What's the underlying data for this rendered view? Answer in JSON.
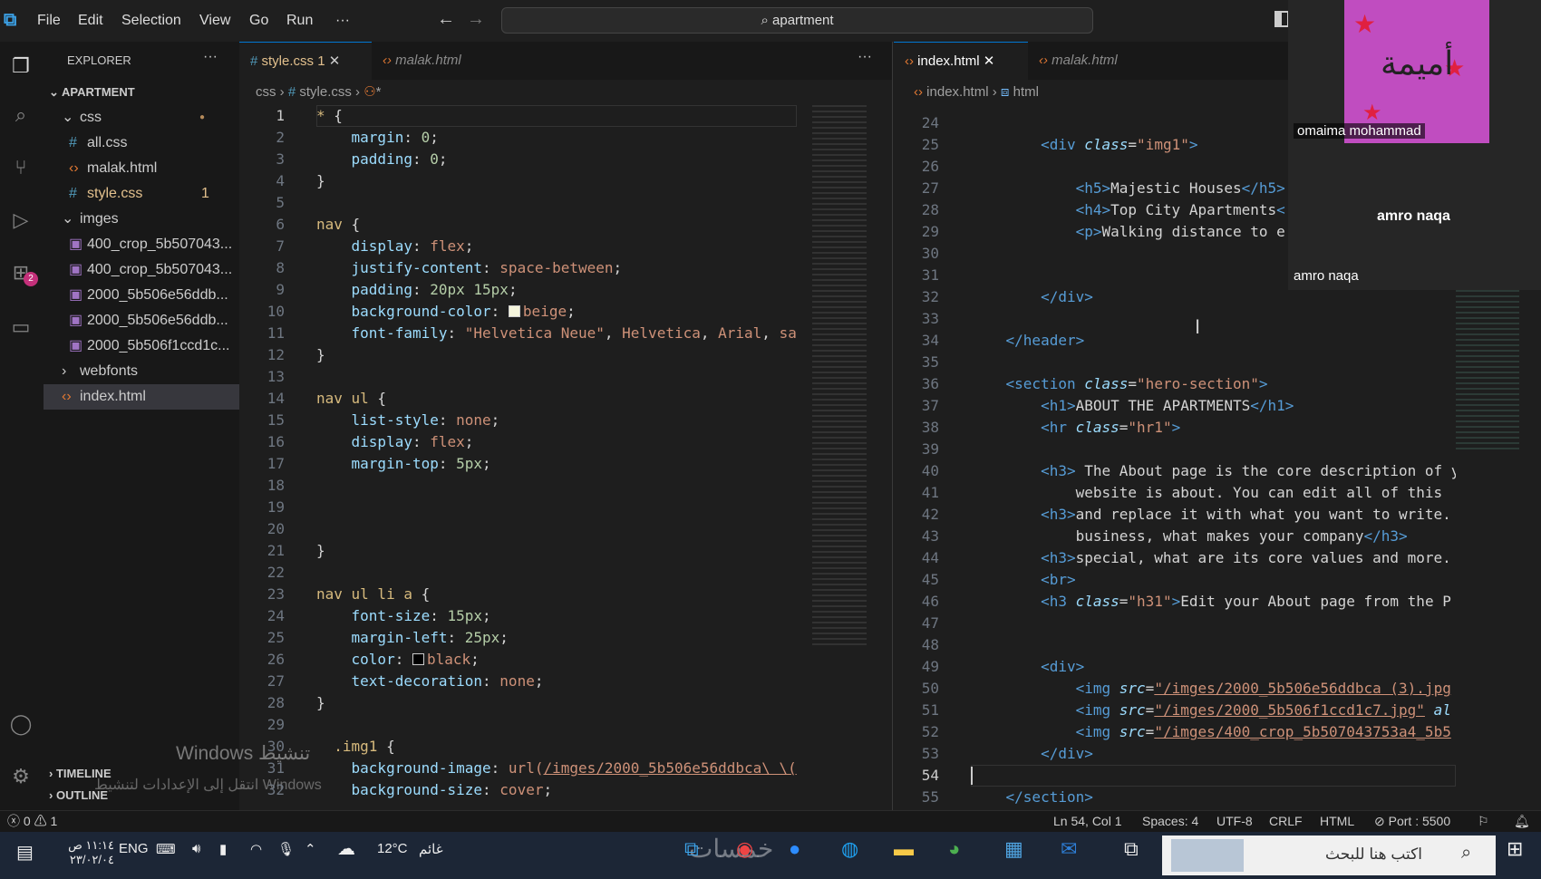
{
  "menu": [
    "File",
    "Edit",
    "Selection",
    "View",
    "Go",
    "Run",
    "···"
  ],
  "search": "apartment",
  "explorer": {
    "title": "EXPLORER",
    "more": "···",
    "root": "APARTMENT",
    "items": [
      {
        "label": "css",
        "kind": "folder",
        "badge": ""
      },
      {
        "label": "all.css",
        "kind": "css",
        "badge": ""
      },
      {
        "label": "malak.html",
        "kind": "html",
        "badge": ""
      },
      {
        "label": "style.css",
        "kind": "css",
        "badge": "1"
      },
      {
        "label": "imges",
        "kind": "folder",
        "badge": ""
      },
      {
        "label": "400_crop_5b507043...",
        "kind": "img",
        "badge": ""
      },
      {
        "label": "400_crop_5b507043...",
        "kind": "img",
        "badge": ""
      },
      {
        "label": "2000_5b506e56ddb...",
        "kind": "img",
        "badge": ""
      },
      {
        "label": "2000_5b506e56ddb...",
        "kind": "img",
        "badge": ""
      },
      {
        "label": "2000_5b506f1ccd1c...",
        "kind": "img",
        "badge": ""
      },
      {
        "label": "webfonts",
        "kind": "folder",
        "badge": ""
      },
      {
        "label": "index.html",
        "kind": "html",
        "badge": ""
      }
    ],
    "timeline": "TIMELINE",
    "outline": "OUTLINE",
    "watermark1": "Windows تنشيط",
    "watermark2": "انتقل إلى الإعدادات لتنشيط Windows"
  },
  "left_tabs": [
    {
      "label": "style.css",
      "badge": "1"
    },
    {
      "label": "malak.html",
      "badge": ""
    }
  ],
  "left_more": "···",
  "left_breadcrumb": [
    "css",
    "#",
    "style.css",
    "*"
  ],
  "right_tabs": [
    {
      "label": "index.html"
    },
    {
      "label": "malak.html"
    }
  ],
  "right_breadcrumb": [
    "index.html",
    "html"
  ],
  "css_start": 1,
  "css_lines": [
    [
      [
        "k",
        "*"
      ],
      [
        "c",
        " {"
      ]
    ],
    [
      [
        "p",
        "    margin"
      ],
      [
        "c",
        ": "
      ],
      [
        "n",
        "0"
      ],
      [
        "c",
        ";"
      ]
    ],
    [
      [
        "p",
        "    padding"
      ],
      [
        "c",
        ": "
      ],
      [
        "n",
        "0"
      ],
      [
        "c",
        ";"
      ]
    ],
    [
      [
        "c",
        "}"
      ]
    ],
    [],
    [
      [
        "k",
        "nav"
      ],
      [
        "c",
        " {"
      ]
    ],
    [
      [
        "p",
        "    display"
      ],
      [
        "c",
        ": "
      ],
      [
        "v",
        "flex"
      ],
      [
        "c",
        ";"
      ]
    ],
    [
      [
        "p",
        "    justify-content"
      ],
      [
        "c",
        ": "
      ],
      [
        "v",
        "space-between"
      ],
      [
        "c",
        ";"
      ]
    ],
    [
      [
        "p",
        "    padding"
      ],
      [
        "c",
        ": "
      ],
      [
        "n",
        "20px 15px"
      ],
      [
        "c",
        ";"
      ]
    ],
    [
      [
        "p",
        "    background-color"
      ],
      [
        "c",
        ": "
      ],
      [
        "sw",
        "#f5f5dc"
      ],
      [
        "v",
        "beige"
      ],
      [
        "c",
        ";"
      ]
    ],
    [
      [
        "p",
        "    font-family"
      ],
      [
        "c",
        ": "
      ],
      [
        "s",
        "\"Helvetica Neue\""
      ],
      [
        "c",
        ", "
      ],
      [
        "v",
        "Helvetica"
      ],
      [
        "c",
        ", "
      ],
      [
        "v",
        "Arial"
      ],
      [
        "c",
        ", "
      ],
      [
        "v",
        "sa"
      ]
    ],
    [
      [
        "c",
        "}"
      ]
    ],
    [],
    [
      [
        "k",
        "nav ul"
      ],
      [
        "c",
        " {"
      ]
    ],
    [
      [
        "p",
        "    list-style"
      ],
      [
        "c",
        ": "
      ],
      [
        "v",
        "none"
      ],
      [
        "c",
        ";"
      ]
    ],
    [
      [
        "p",
        "    display"
      ],
      [
        "c",
        ": "
      ],
      [
        "v",
        "flex"
      ],
      [
        "c",
        ";"
      ]
    ],
    [
      [
        "p",
        "    margin-top"
      ],
      [
        "c",
        ": "
      ],
      [
        "n",
        "5px"
      ],
      [
        "c",
        ";"
      ]
    ],
    [],
    [],
    [],
    [
      [
        "c",
        "}"
      ]
    ],
    [],
    [
      [
        "k",
        "nav ul li a"
      ],
      [
        "c",
        " {"
      ]
    ],
    [
      [
        "p",
        "    font-size"
      ],
      [
        "c",
        ": "
      ],
      [
        "n",
        "15px"
      ],
      [
        "c",
        ";"
      ]
    ],
    [
      [
        "p",
        "    margin-left"
      ],
      [
        "c",
        ": "
      ],
      [
        "n",
        "25px"
      ],
      [
        "c",
        ";"
      ]
    ],
    [
      [
        "p",
        "    color"
      ],
      [
        "c",
        ": "
      ],
      [
        "sw",
        "#000000"
      ],
      [
        "v",
        "black"
      ],
      [
        "c",
        ";"
      ]
    ],
    [
      [
        "p",
        "    text-decoration"
      ],
      [
        "c",
        ": "
      ],
      [
        "v",
        "none"
      ],
      [
        "c",
        ";"
      ]
    ],
    [
      [
        "c",
        "}"
      ]
    ],
    [],
    [
      [
        "k",
        "  .img1"
      ],
      [
        "c",
        " {"
      ]
    ],
    [
      [
        "p",
        "    background-image"
      ],
      [
        "c",
        ": "
      ],
      [
        "v",
        "url("
      ],
      [
        "u",
        "/imges/2000_5b506e56ddbca\\ \\("
      ]
    ],
    [
      [
        "p",
        "    background-size"
      ],
      [
        "c",
        ": "
      ],
      [
        "v",
        "cover"
      ],
      [
        "c",
        ";"
      ]
    ]
  ],
  "html_start": 24,
  "html_lines": [
    [],
    [
      [
        "c",
        "        "
      ],
      [
        "t",
        "<div "
      ],
      [
        "a",
        "class"
      ],
      [
        "c",
        "="
      ],
      [
        "s",
        "\"img1\""
      ],
      [
        "t",
        ">"
      ]
    ],
    [],
    [
      [
        "c",
        "            "
      ],
      [
        "t",
        "<h5>"
      ],
      [
        "c",
        "Majestic Houses"
      ],
      [
        "t",
        "</h5>"
      ]
    ],
    [
      [
        "c",
        "            "
      ],
      [
        "t",
        "<h4>"
      ],
      [
        "c",
        "Top City Apartments"
      ],
      [
        "t",
        "<"
      ]
    ],
    [
      [
        "c",
        "            "
      ],
      [
        "t",
        "<p>"
      ],
      [
        "c",
        "Walking distance to e"
      ]
    ],
    [],
    [],
    [
      [
        "c",
        "        "
      ],
      [
        "t",
        "</div>"
      ]
    ],
    [],
    [
      [
        "c",
        "    "
      ],
      [
        "t",
        "</header>"
      ]
    ],
    [],
    [
      [
        "c",
        "    "
      ],
      [
        "t",
        "<section "
      ],
      [
        "a",
        "class"
      ],
      [
        "c",
        "="
      ],
      [
        "s",
        "\"hero-section\""
      ],
      [
        "t",
        ">"
      ]
    ],
    [
      [
        "c",
        "        "
      ],
      [
        "t",
        "<h1>"
      ],
      [
        "c",
        "ABOUT THE APARTMENTS"
      ],
      [
        "t",
        "</h1>"
      ]
    ],
    [
      [
        "c",
        "        "
      ],
      [
        "t",
        "<hr "
      ],
      [
        "a",
        "class"
      ],
      [
        "c",
        "="
      ],
      [
        "s",
        "\"hr1\""
      ],
      [
        "t",
        ">"
      ]
    ],
    [],
    [
      [
        "c",
        "        "
      ],
      [
        "t",
        "<h3>"
      ],
      [
        "c",
        " The About page is the core description of y"
      ]
    ],
    [
      [
        "c",
        "            website is about. You can edit all of this"
      ]
    ],
    [
      [
        "c",
        "        "
      ],
      [
        "t",
        "<h3>"
      ],
      [
        "c",
        "and replace it with what you want to write."
      ]
    ],
    [
      [
        "c",
        "            business, what makes your company"
      ],
      [
        "t",
        "</h3>"
      ]
    ],
    [
      [
        "c",
        "        "
      ],
      [
        "t",
        "<h3>"
      ],
      [
        "c",
        "special, what are its core values and more."
      ]
    ],
    [
      [
        "c",
        "        "
      ],
      [
        "t",
        "<br>"
      ]
    ],
    [
      [
        "c",
        "        "
      ],
      [
        "t",
        "<h3 "
      ],
      [
        "a",
        "class"
      ],
      [
        "c",
        "="
      ],
      [
        "s",
        "\"h31\""
      ],
      [
        "t",
        ">"
      ],
      [
        "c",
        "Edit your About page from the P"
      ]
    ],
    [],
    [],
    [
      [
        "c",
        "        "
      ],
      [
        "t",
        "<div>"
      ]
    ],
    [
      [
        "c",
        "            "
      ],
      [
        "t",
        "<img "
      ],
      [
        "a",
        "src"
      ],
      [
        "c",
        "="
      ],
      [
        "u",
        "\"/imges/2000_5b506e56ddbca (3).jpg"
      ]
    ],
    [
      [
        "c",
        "            "
      ],
      [
        "t",
        "<img "
      ],
      [
        "a",
        "src"
      ],
      [
        "c",
        "="
      ],
      [
        "u",
        "\"/imges/2000_5b506f1ccd1c7.jpg\""
      ],
      [
        "a",
        " al"
      ]
    ],
    [
      [
        "c",
        "            "
      ],
      [
        "t",
        "<img "
      ],
      [
        "a",
        "src"
      ],
      [
        "c",
        "="
      ],
      [
        "u",
        "\"/imges/400_crop_5b507043753a4_5b5"
      ]
    ],
    [
      [
        "c",
        "        "
      ],
      [
        "t",
        "</div>"
      ]
    ],
    [],
    [
      [
        "c",
        "    "
      ],
      [
        "t",
        "</section>"
      ]
    ]
  ],
  "html_current_line": 54,
  "video": {
    "person1": "omaima mohammad",
    "person2_center": "amro naqa",
    "person2_label": "amro naqa",
    "photo_text": "أميمة"
  },
  "status": {
    "errors": "0",
    "warnings": "1",
    "position": "Ln 54, Col 1",
    "spaces": "Spaces: 4",
    "encoding": "UTF-8",
    "eol": "CRLF",
    "lang": "HTML",
    "port": "Port : 5500"
  },
  "taskbar": {
    "time": "١١:١٤ ص",
    "date": "٢٣/٠٢/٠٤",
    "lang": "ENG",
    "temp": "12°C",
    "weather": "غائم",
    "search": "اكتب هنا للبحث",
    "logo_text": "خمسات"
  },
  "colors": {
    "accent": "#0078d4",
    "modified": "#e2c08d",
    "folder": "#ccc"
  }
}
